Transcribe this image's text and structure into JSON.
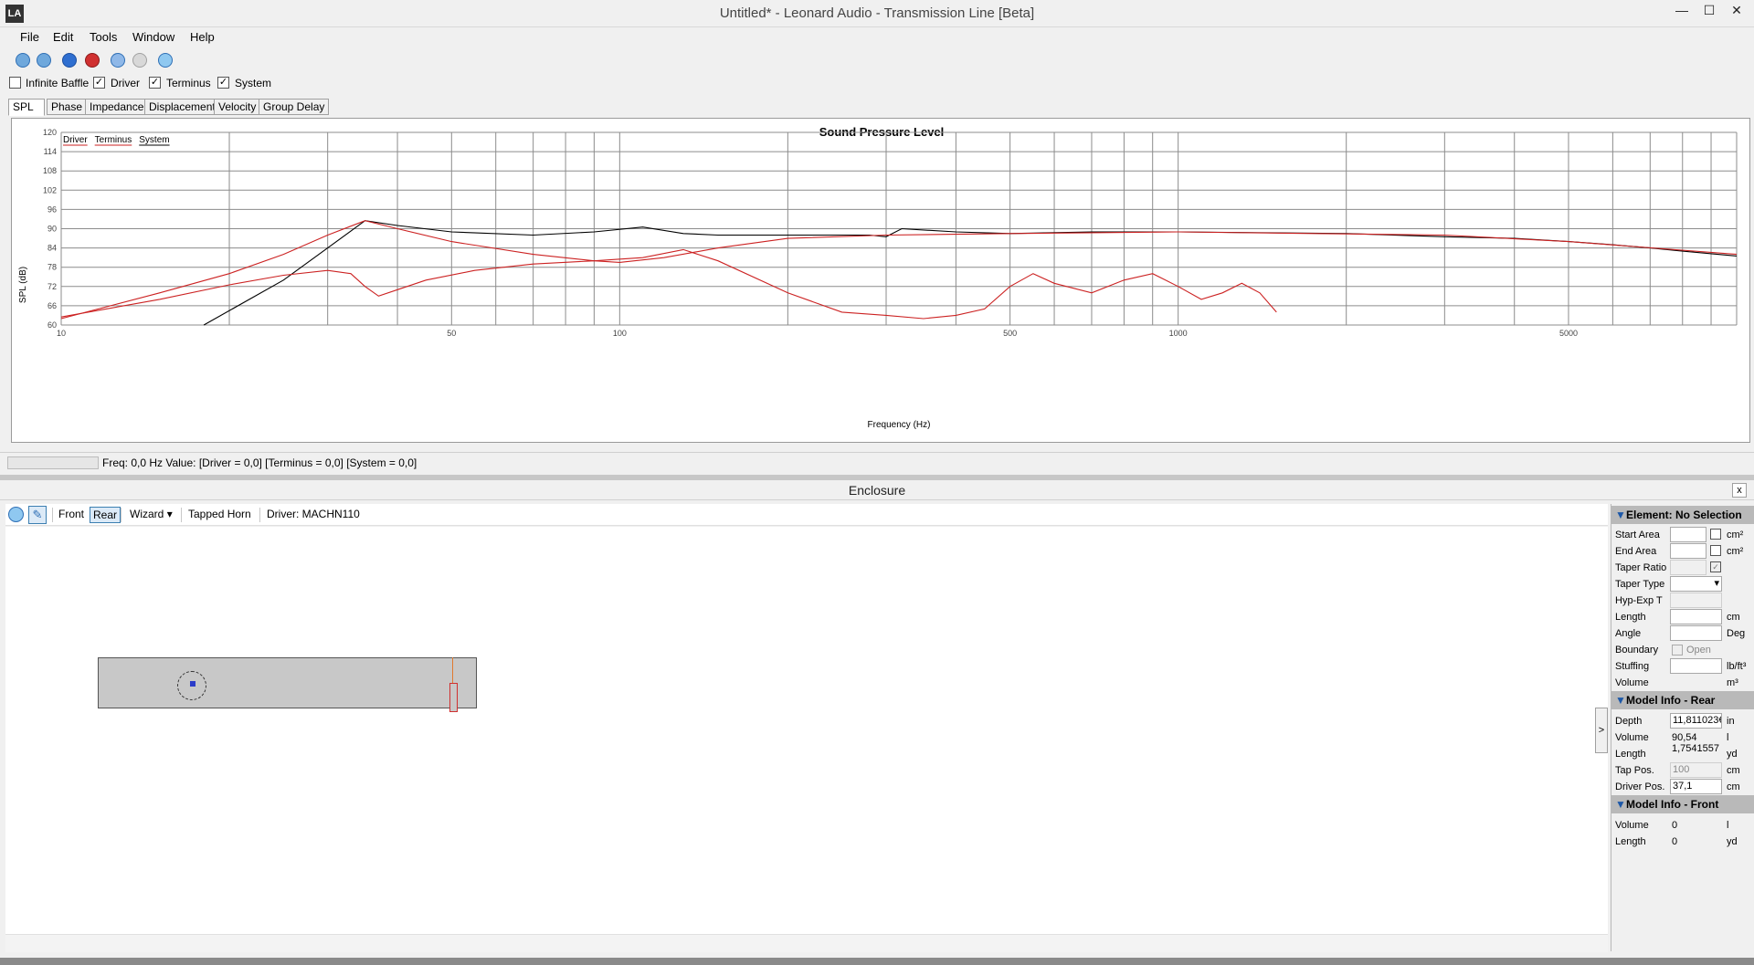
{
  "window": {
    "title": "Untitled* - Leonard Audio - Transmission Line [Beta]",
    "logo": "LA",
    "minimize_icon": "—",
    "maximize_icon": "☐",
    "close_icon": "✕"
  },
  "menu": [
    "File",
    "Edit",
    "Tools",
    "Window",
    "Help"
  ],
  "toolbar_icons": [
    "new-icon",
    "open-icon",
    "record-icon",
    "stop-icon",
    "back-icon",
    "forward-icon",
    "play-icon"
  ],
  "checkboxes": [
    {
      "label": "Infinite Baffle",
      "checked": false
    },
    {
      "label": "Driver",
      "checked": true
    },
    {
      "label": "Terminus",
      "checked": true
    },
    {
      "label": "System",
      "checked": true
    }
  ],
  "tabs": [
    "SPL",
    "Phase",
    "Impedance",
    "Displacement",
    "Velocity",
    "Group Delay"
  ],
  "chart_data": {
    "type": "line",
    "title": "Sound Pressure Level",
    "xlabel": "Frequency (Hz)",
    "ylabel": "SPL (dB)",
    "xscale": "log",
    "xlim": [
      10,
      10000
    ],
    "ylim": [
      60,
      120
    ],
    "yticks": [
      60,
      66,
      72,
      78,
      84,
      90,
      96,
      102,
      108,
      114,
      120
    ],
    "xtick_labels": [
      {
        "value": 10,
        "label": "10"
      },
      {
        "value": 50,
        "label": "50"
      },
      {
        "value": 100,
        "label": "100"
      },
      {
        "value": 500,
        "label": "500"
      },
      {
        "value": 1000,
        "label": "1000"
      },
      {
        "value": 5000,
        "label": "5000"
      }
    ],
    "legend": [
      "Driver",
      "Terminus",
      "System"
    ],
    "legend_position": "top-left",
    "grid": true,
    "series": [
      {
        "name": "System",
        "color": "#000000",
        "points": [
          [
            18,
            60
          ],
          [
            25,
            74
          ],
          [
            30,
            84
          ],
          [
            35,
            92.5
          ],
          [
            40,
            91
          ],
          [
            50,
            89
          ],
          [
            70,
            88
          ],
          [
            90,
            89
          ],
          [
            110,
            90.5
          ],
          [
            130,
            88.5
          ],
          [
            150,
            88
          ],
          [
            200,
            88
          ],
          [
            280,
            88
          ],
          [
            300,
            87.5
          ],
          [
            320,
            90
          ],
          [
            400,
            89
          ],
          [
            500,
            88.5
          ],
          [
            700,
            89
          ],
          [
            1000,
            89
          ],
          [
            2000,
            88.5
          ],
          [
            3000,
            87.5
          ],
          [
            4000,
            87
          ],
          [
            5000,
            86
          ],
          [
            6000,
            85
          ],
          [
            7000,
            84
          ],
          [
            8000,
            83
          ],
          [
            10000,
            81.5
          ]
        ]
      },
      {
        "name": "Driver",
        "color": "#cc2222",
        "points": [
          [
            10,
            62
          ],
          [
            15,
            70
          ],
          [
            20,
            76
          ],
          [
            25,
            82
          ],
          [
            30,
            88
          ],
          [
            35,
            92.5
          ],
          [
            40,
            90
          ],
          [
            50,
            86
          ],
          [
            70,
            82
          ],
          [
            90,
            80
          ],
          [
            100,
            79.5
          ],
          [
            120,
            81
          ],
          [
            150,
            84
          ],
          [
            200,
            87
          ],
          [
            300,
            88
          ],
          [
            500,
            88.5
          ],
          [
            1000,
            89
          ],
          [
            3000,
            88
          ],
          [
            5000,
            86
          ],
          [
            10000,
            82
          ]
        ]
      },
      {
        "name": "Terminus",
        "color": "#cc2222",
        "points": [
          [
            10,
            62.5
          ],
          [
            15,
            68
          ],
          [
            20,
            72.5
          ],
          [
            25,
            75.5
          ],
          [
            30,
            77
          ],
          [
            33,
            76
          ],
          [
            35,
            72
          ],
          [
            37,
            69
          ],
          [
            40,
            71
          ],
          [
            45,
            74
          ],
          [
            55,
            77
          ],
          [
            70,
            79
          ],
          [
            90,
            80
          ],
          [
            110,
            81
          ],
          [
            130,
            83.5
          ],
          [
            150,
            80
          ],
          [
            200,
            70
          ],
          [
            250,
            64
          ],
          [
            300,
            63
          ],
          [
            350,
            62
          ],
          [
            400,
            63
          ],
          [
            450,
            65
          ],
          [
            500,
            72
          ],
          [
            550,
            76
          ],
          [
            600,
            73
          ],
          [
            700,
            70
          ],
          [
            800,
            74
          ],
          [
            900,
            76
          ],
          [
            1000,
            72
          ],
          [
            1100,
            68
          ],
          [
            1200,
            70
          ],
          [
            1300,
            73
          ],
          [
            1400,
            70
          ],
          [
            1500,
            64
          ]
        ]
      }
    ]
  },
  "status": {
    "text": "Freq: 0,0 Hz   Value: [Driver = 0,0]  [Terminus = 0,0]  [System = 0,0]"
  },
  "enclosure": {
    "title": "Enclosure",
    "close_icon": "x",
    "toolbar": {
      "front": "Front",
      "rear": "Rear",
      "wizard": "Wizard",
      "wizard_arrow": "▾",
      "type": "Tapped Horn",
      "driver": "Driver: MACHN110"
    },
    "collapse_icon": ">"
  },
  "properties": {
    "element_section": "Element: No Selection",
    "element_rows": [
      {
        "label": "Start Area",
        "unit": "cm²"
      },
      {
        "label": "End Area",
        "unit": "cm²"
      },
      {
        "label": "Taper Ratio",
        "unit": ""
      },
      {
        "label": "Taper Type",
        "unit": ""
      },
      {
        "label": "Hyp-Exp T",
        "unit": ""
      },
      {
        "label": "Length",
        "unit": "cm"
      },
      {
        "label": "Angle",
        "unit": "Deg"
      },
      {
        "label": "Boundary",
        "unit": "Open"
      },
      {
        "label": "Stuffing",
        "unit": "lb/ft³"
      },
      {
        "label": "Volume",
        "unit": "m³"
      }
    ],
    "rear_section": "Model Info - Rear",
    "rear_rows": [
      {
        "label": "Depth",
        "value": "11,811023€",
        "unit": "in"
      },
      {
        "label": "Volume",
        "value": "90,54",
        "unit": "l"
      },
      {
        "label": "Length",
        "value": "1,7541557",
        "unit": "yd"
      },
      {
        "label": "Tap Pos.",
        "value": "100",
        "unit": "cm"
      },
      {
        "label": "Driver Pos.",
        "value": "37,1",
        "unit": "cm"
      }
    ],
    "front_section": "Model Info - Front",
    "front_rows": [
      {
        "label": "Volume",
        "value": "0",
        "unit": "l"
      },
      {
        "label": "Length",
        "value": "0",
        "unit": "yd"
      }
    ]
  }
}
